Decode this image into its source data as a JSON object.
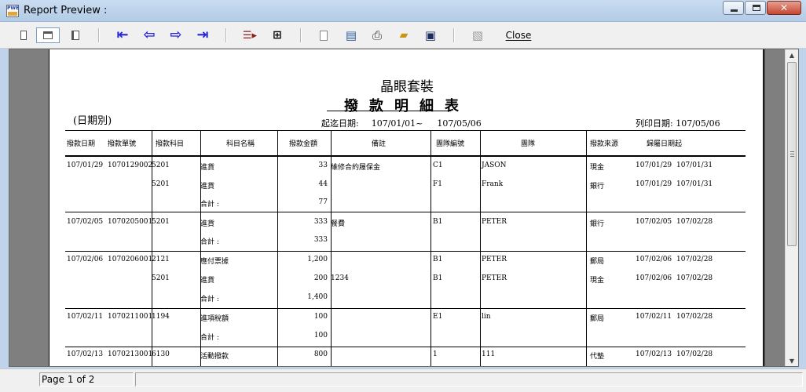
{
  "window": {
    "title": "Report Preview :",
    "app_icon_text": "PWE"
  },
  "toolbar": {
    "close_label": "Close",
    "icons": [
      "single-page-icon",
      "two-page-icon",
      "page-width-icon",
      "first-page-icon",
      "previous-page-icon",
      "next-page-icon",
      "last-page-icon",
      "goto-page-icon",
      "find-icon",
      "new-page-icon",
      "export-icon",
      "print-icon",
      "open-icon",
      "save-icon",
      "disabled-icon"
    ]
  },
  "report": {
    "company": "晶眼套裝",
    "title": "撥款明細表",
    "subtitle": "(日期別)",
    "range_label": "起迄日期:",
    "range_from": "107/01/01~",
    "range_to": "107/05/06",
    "print_date": "列印日期: 107/05/06",
    "headers": [
      "撥款日期",
      "撥款單號",
      "撥款科目",
      "科目名稱",
      "撥款金額",
      "備註",
      "團隊編號",
      "團隊",
      "撥款來源",
      "歸屬日期起"
    ],
    "rows": [
      {
        "date": "107/01/29",
        "no": "1070129002",
        "subject": "5201",
        "name": "進貨",
        "amount": "33",
        "note": "維修合約履保金",
        "team_no": "C1",
        "team": "JASON",
        "source": "現金",
        "from": "107/01/29",
        "to": "107/01/31"
      },
      {
        "date": "",
        "no": "",
        "subject": "5201",
        "name": "進貨",
        "amount": "44",
        "note": "",
        "team_no": "F1",
        "team": "Frank",
        "source": "銀行",
        "from": "107/01/29",
        "to": "107/01/31"
      },
      {
        "date": "",
        "no": "",
        "subject": "",
        "name": "合計 :",
        "amount": "77",
        "note": "",
        "team_no": "",
        "team": "",
        "source": "",
        "from": "",
        "to": ""
      },
      {
        "date": "107/02/05",
        "no": "1070205001",
        "subject": "5201",
        "name": "進貨",
        "amount": "333",
        "note": "餐費",
        "team_no": "B1",
        "team": "PETER",
        "source": "銀行",
        "from": "107/02/05",
        "to": "107/02/28"
      },
      {
        "date": "",
        "no": "",
        "subject": "",
        "name": "合計 :",
        "amount": "333",
        "note": "",
        "team_no": "",
        "team": "",
        "source": "",
        "from": "",
        "to": ""
      },
      {
        "date": "107/02/06",
        "no": "1070206001",
        "subject": "2121",
        "name": "應付票據",
        "amount": "1,200",
        "note": "",
        "team_no": "B1",
        "team": "PETER",
        "source": "郵局",
        "from": "107/02/06",
        "to": "107/02/28"
      },
      {
        "date": "",
        "no": "",
        "subject": "5201",
        "name": "進貨",
        "amount": "200",
        "note": "1234",
        "team_no": "B1",
        "team": "PETER",
        "source": "現金",
        "from": "107/02/06",
        "to": "107/02/28"
      },
      {
        "date": "",
        "no": "",
        "subject": "",
        "name": "合計 :",
        "amount": "1,400",
        "note": "",
        "team_no": "",
        "team": "",
        "source": "",
        "from": "",
        "to": ""
      },
      {
        "date": "107/02/11",
        "no": "1070211001",
        "subject": "1194",
        "name": "進項稅額",
        "amount": "100",
        "note": "",
        "team_no": "E1",
        "team": "lin",
        "source": "郵局",
        "from": "107/02/11",
        "to": "107/02/28"
      },
      {
        "date": "",
        "no": "",
        "subject": "",
        "name": "合計 :",
        "amount": "100",
        "note": "",
        "team_no": "",
        "team": "",
        "source": "",
        "from": "",
        "to": ""
      },
      {
        "date": "107/02/13",
        "no": "1070213001",
        "subject": "6130",
        "name": "活動撥款",
        "amount": "800",
        "note": "",
        "team_no": "1",
        "team": "111",
        "source": "代墊",
        "from": "107/02/13",
        "to": "107/02/28"
      }
    ]
  },
  "status": {
    "page": "Page 1 of 2"
  }
}
